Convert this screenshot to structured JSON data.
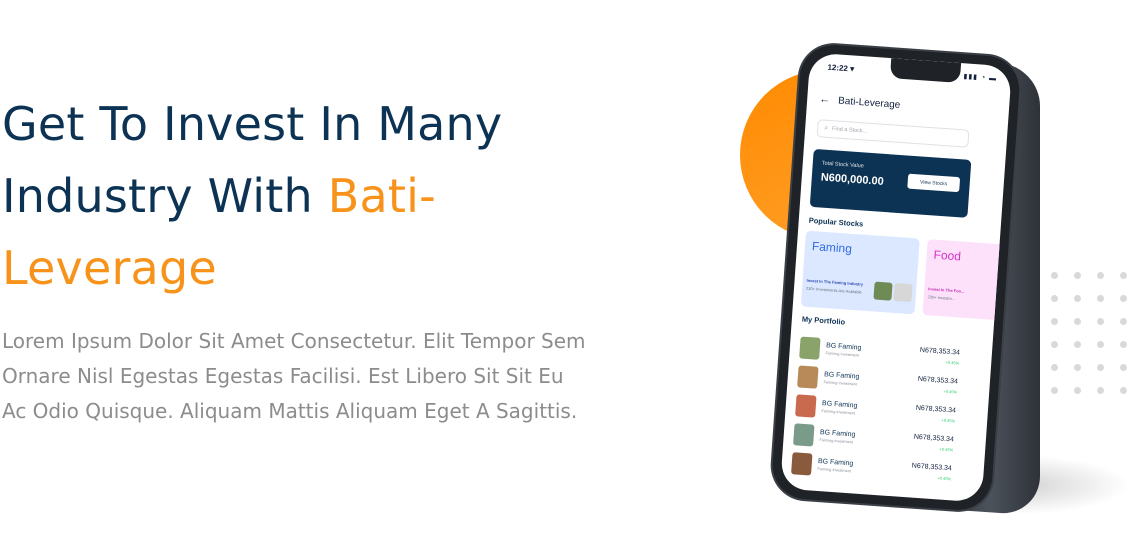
{
  "hero": {
    "title_line1": "Get To Invest In Many",
    "title_line2_prefix": "Industry With ",
    "title_line2_accent": "Bati-",
    "title_line3_accent": "Leverage",
    "description": "Lorem Ipsum Dolor Sit Amet Consectetur. Elit Tempor Sem Ornare Nisl Egestas Egestas Facilisi. Est Libero Sit Sit Eu Ac Odio Quisque. Aliquam Mattis Aliquam Eget A Sagittis."
  },
  "colors": {
    "navy": "#0d3354",
    "accent": "#f7931a",
    "text_muted": "#8c8c8c"
  },
  "phone": {
    "status_time": "12:22 ▾",
    "status_icons": "▮▮▮ ◔ ▬",
    "header": {
      "back_icon": "←",
      "title": "Bati-Leverage"
    },
    "search": {
      "icon": "search-icon",
      "placeholder": "Find a Stock..."
    },
    "stock_card": {
      "label": "Total Stock Value",
      "value": "N600,000.00",
      "button": "View Stocks"
    },
    "popular_title": "Popular Stocks",
    "popular": [
      {
        "name": "Faming",
        "line1": "Invest In The Faming Industry",
        "line2": "230+ Investments Are Available"
      },
      {
        "name": "Food",
        "line1": "Invest In The Foo...",
        "line2": "230+ Investm..."
      }
    ],
    "portfolio_title": "My Portfolio",
    "portfolio": [
      {
        "name": "BG Faming",
        "sub": "Farming Investment",
        "amount": "N678,353.34",
        "change": "+0.45%"
      },
      {
        "name": "BG Faming",
        "sub": "Farming Investment",
        "amount": "N678,353.34",
        "change": "+0.45%"
      },
      {
        "name": "BG Faming",
        "sub": "Farming Investment",
        "amount": "N678,353.34",
        "change": "+0.45%"
      },
      {
        "name": "BG Faming",
        "sub": "Farming Investment",
        "amount": "N678,353.34",
        "change": "+0.45%"
      },
      {
        "name": "BG Faming",
        "sub": "Farming Investment",
        "amount": "N678,353.34",
        "change": "+0.45%"
      }
    ]
  }
}
